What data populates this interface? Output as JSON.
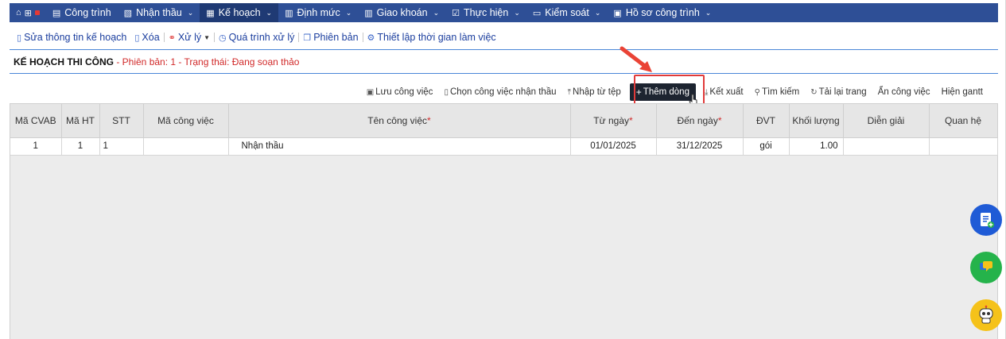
{
  "nav": {
    "items": [
      {
        "label": "Công trình",
        "icon": "table-icon",
        "chevron": false,
        "active": false
      },
      {
        "label": "Nhận thầu",
        "icon": "clipboard-icon",
        "chevron": true,
        "active": false
      },
      {
        "label": "Kế hoạch",
        "icon": "calendar-icon",
        "chevron": true,
        "active": true
      },
      {
        "label": "Định mức",
        "icon": "document-icon",
        "chevron": true,
        "active": false
      },
      {
        "label": "Giao khoán",
        "icon": "document-icon",
        "chevron": true,
        "active": false
      },
      {
        "label": "Thực hiện",
        "icon": "checkbox-icon",
        "chevron": true,
        "active": false
      },
      {
        "label": "Kiểm soát",
        "icon": "monitor-icon",
        "chevron": true,
        "active": false
      },
      {
        "label": "Hồ sơ công trình",
        "icon": "briefcase-icon",
        "chevron": true,
        "active": false
      }
    ]
  },
  "toolbar": {
    "edit": "Sửa thông tin kế hoạch",
    "delete": "Xóa",
    "process": "Xử lý",
    "history": "Quá trình xử lý",
    "version": "Phiên bản",
    "worktime": "Thiết lập thời gian làm việc"
  },
  "plan": {
    "title": "KẾ HOẠCH THI CÔNG",
    "subtitle": " - Phiên bản: 1 - Trạng thái: Đang soạn thảo"
  },
  "actions": {
    "save": "Lưu công việc",
    "choose": "Chọn công việc nhận thầu",
    "import": "Nhập từ tệp",
    "add_row": "Thêm dòng",
    "export": "Kết xuất",
    "search": "Tìm kiếm",
    "reload": "Tải lại trang",
    "hide": "Ẩn công việc",
    "gantt": "Hiện gantt"
  },
  "table": {
    "headers": [
      {
        "label": "Mã CVAB",
        "required": false
      },
      {
        "label": "Mã HT",
        "required": false
      },
      {
        "label": "STT",
        "required": false
      },
      {
        "label": "Mã công việc",
        "required": false
      },
      {
        "label": "Tên công việc",
        "required": true
      },
      {
        "label": "Từ ngày",
        "required": true
      },
      {
        "label": "Đến ngày",
        "required": true
      },
      {
        "label": "ĐVT",
        "required": false
      },
      {
        "label": "Khối lượng",
        "required": false
      },
      {
        "label": "Diễn giải",
        "required": false
      },
      {
        "label": "Quan hệ",
        "required": false
      }
    ],
    "rows": [
      [
        "1",
        "1",
        "1",
        "",
        "Nhận thầu",
        "01/01/2025",
        "31/12/2025",
        "gói",
        "1.00",
        "",
        ""
      ]
    ]
  },
  "colors": {
    "nav_bg": "#2e4f96",
    "nav_active": "#1f3a74",
    "link": "#1b3e9e",
    "status_red": "#d12a2a",
    "primary_btn": "#1d2430",
    "highlight": "#e03a3a"
  }
}
